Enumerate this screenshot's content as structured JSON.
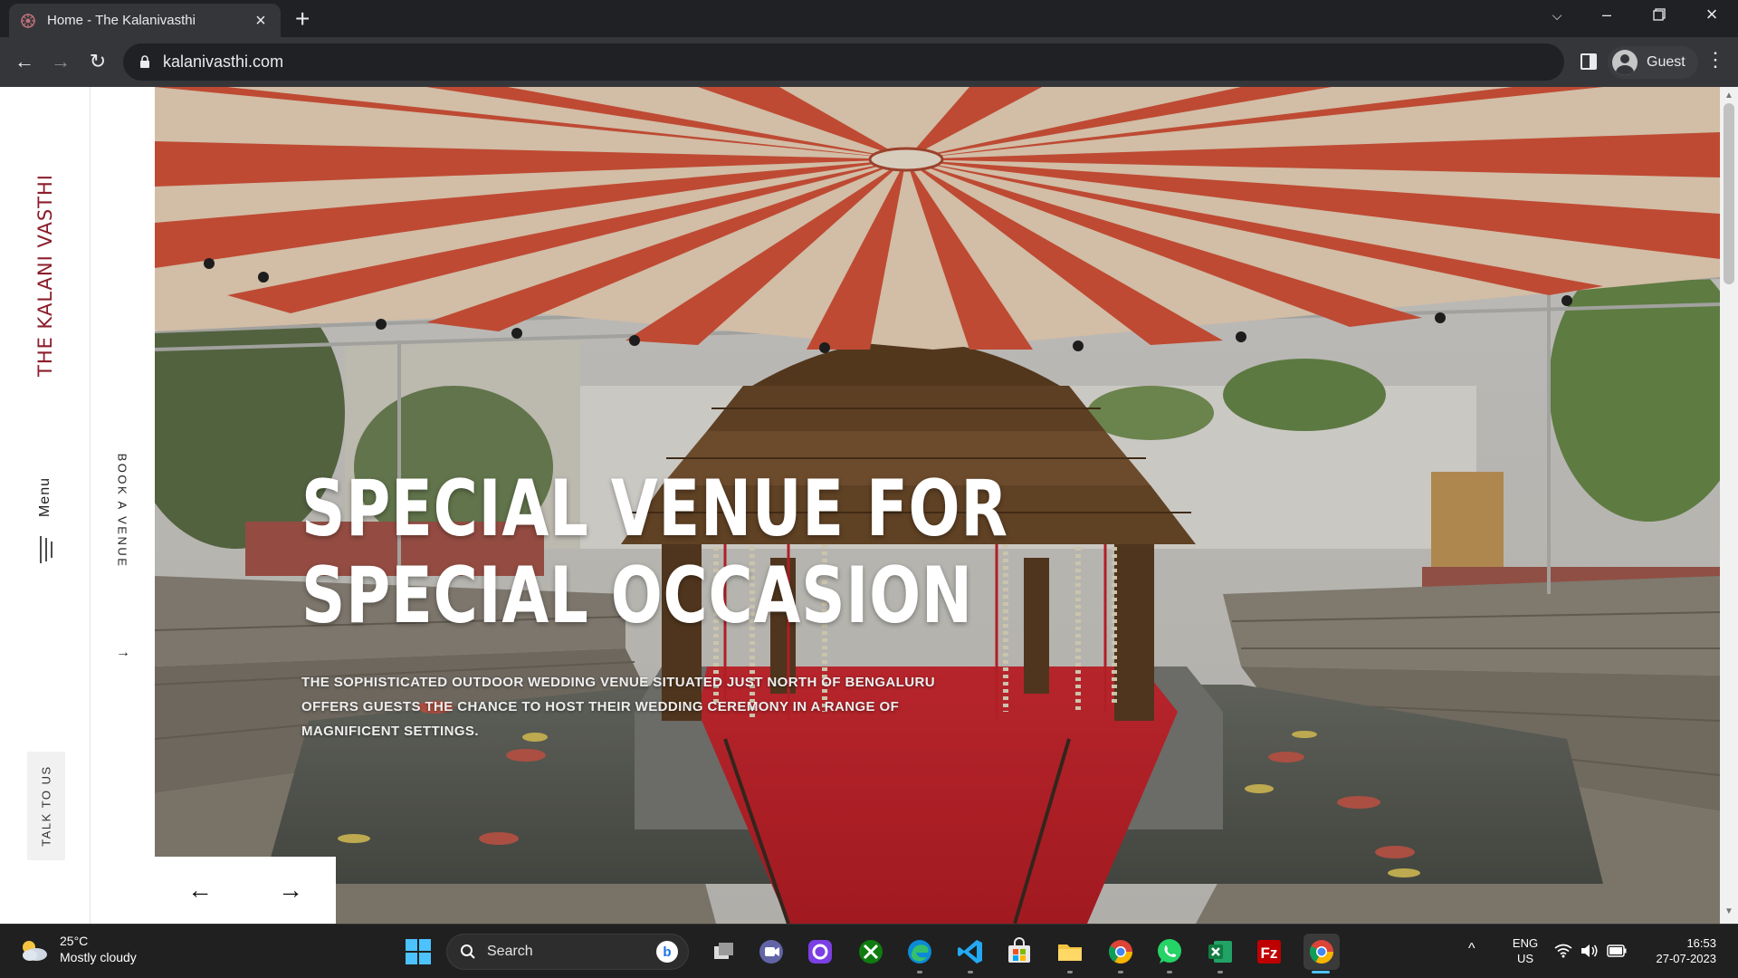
{
  "browser": {
    "tab_title": "Home - The Kalanivasthi",
    "url": "kalanivasthi.com",
    "profile_label": "Guest"
  },
  "site": {
    "brand": "THE KALANI VASTHI",
    "menu_label": "Menu",
    "book_label": "BOOK A VENUE",
    "talk_label": "TALK TO US",
    "hero_title_line1": "SPECIAL VENUE FOR",
    "hero_title_line2": "SPECIAL OCCASION",
    "hero_desc": "THE SOPHISTICATED OUTDOOR WEDDING VENUE SITUATED JUST NORTH OF BENGALURU OFFERS GUESTS THE CHANCE TO HOST THEIR WEDDING CEREMONY IN A RANGE OF MAGNIFICENT SETTINGS.",
    "prev_arrow": "←",
    "next_arrow": "→"
  },
  "taskbar": {
    "weather_temp": "25°C",
    "weather_desc": "Mostly cloudy",
    "search_label": "Search",
    "lang_line1": "ENG",
    "lang_line2": "US",
    "time": "16:53",
    "date": "27-07-2023"
  },
  "colors": {
    "brand": "#8b1e2b",
    "canopy_red": "#d9533a",
    "canopy_cream": "#f1ddc3",
    "carpet_red": "#c8202a"
  }
}
